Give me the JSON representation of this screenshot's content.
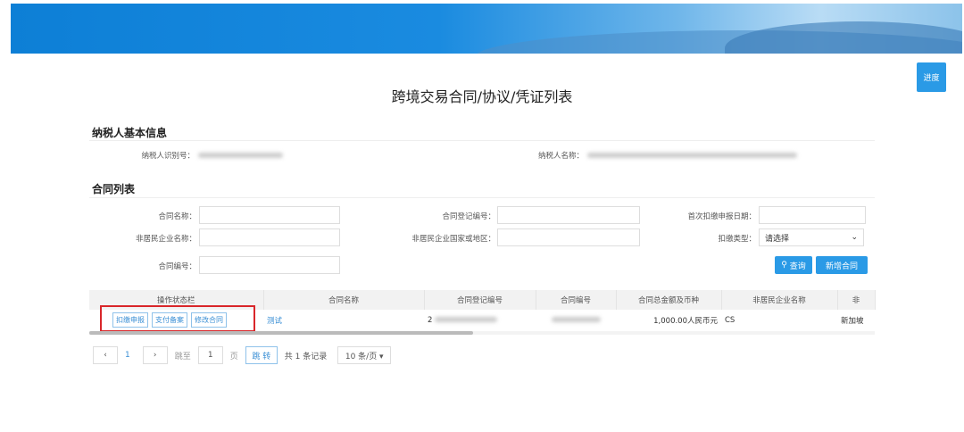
{
  "header": {
    "progress_button": "进度",
    "title": "跨境交易合同/协议/凭证列表"
  },
  "taxpayer": {
    "section_title": "纳税人基本信息",
    "id_label": "纳税人识别号：",
    "name_label": "纳税人名称："
  },
  "contracts": {
    "section_title": "合同列表",
    "filters": {
      "contract_name": "合同名称：",
      "reg_no": "合同登记编号：",
      "first_date": "首次扣缴申报日期：",
      "nonres_name": "非居民企业名称：",
      "nonres_country": "非居民企业国家或地区：",
      "withhold_type": "扣缴类型：",
      "withhold_type_value": "请选择",
      "contract_no": "合同编号："
    },
    "query_button": "查询",
    "add_button": "新增合同",
    "columns": [
      "操作状态栏",
      "合同名称",
      "合同登记编号",
      "合同编号",
      "合同总金额及币种",
      "非居民企业名称",
      "非"
    ],
    "rows": [
      {
        "actions": [
          "扣缴申报",
          "支付备案",
          "修改合同"
        ],
        "name": "测试",
        "reg_no_prefix": "2",
        "amount": "1,000.00人民币元",
        "nonres_name": "CS",
        "country": "新加坡"
      }
    ]
  },
  "pagination": {
    "prev": "‹",
    "page": "1",
    "next": "›",
    "goto_label": "跳至",
    "goto_value": "1",
    "page_unit": "页",
    "go_button": "跳 转",
    "total": "共 1 条记录",
    "page_size": "10 条/页 ▾"
  },
  "colors": {
    "accent": "#2a9ae6",
    "highlight": "#d9262a"
  }
}
